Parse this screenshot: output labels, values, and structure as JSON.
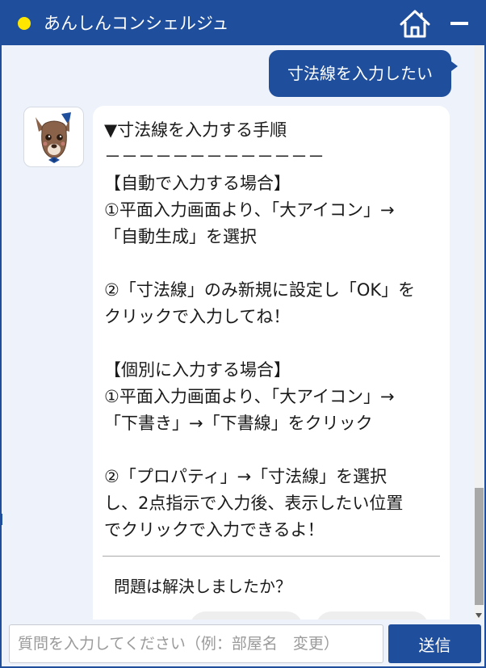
{
  "app": {
    "title": "あんしんコンシェルジュ",
    "accent_color": "#1f4e9c",
    "status_dot_color": "#ffe600",
    "home_icon": "home-icon",
    "minimize_icon": "minimize-icon"
  },
  "chat": {
    "user_message": "寸法線を入力したい",
    "bot_avatar_icon": "deer-mascot-avatar",
    "bot_message": "▼寸法線を入力する手順\n－－－－－－－－－－－－－\n【自動で入力する場合】\n①平面入力画面より、「大アイコン」→\n「自動生成」を選択\n\n②「寸法線」のみ新規に設定し「OK」を\nクリックで入力してね！\n\n【個別に入力する場合】\n①平面入力画面より、「大アイコン」→\n「下書き」→「下書線」をクリック\n\n②「プロパティ」→「寸法線」を選択\nし、2点指示で入力後、表示したい位置\nでクリックで入力できるよ！",
    "resolved_question": "問題は解決しましたか？"
  },
  "input": {
    "placeholder": "質問を入力してください（例：部屋名　変更）",
    "value": "",
    "send_label": "送信"
  }
}
